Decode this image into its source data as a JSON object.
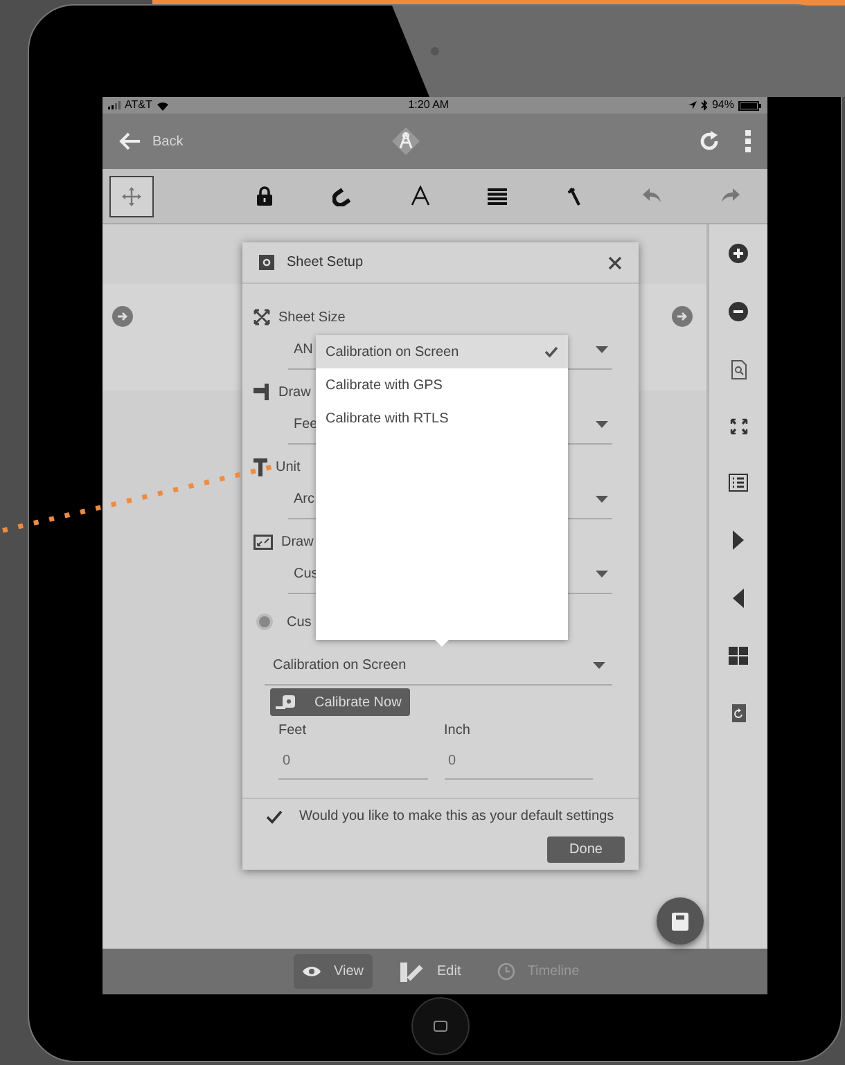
{
  "status_bar": {
    "carrier": "AT&T",
    "time": "1:20 AM",
    "battery": "94%"
  },
  "nav_bar": {
    "back": "Back"
  },
  "toolbar": {
    "tools": [
      {
        "kind": "move",
        "selected": true
      },
      {
        "kind": "lock",
        "selected": false
      },
      {
        "kind": "magnet",
        "selected": false
      },
      {
        "kind": "text",
        "selected": false
      },
      {
        "kind": "lines",
        "selected": false
      },
      {
        "kind": "pen",
        "selected": false
      },
      {
        "kind": "undo",
        "selected": false
      },
      {
        "kind": "redo",
        "selected": false
      }
    ]
  },
  "dialog": {
    "title": "Sheet Setup",
    "fields": [
      {
        "kind": "resize",
        "label": "Sheet Size",
        "value": "AN"
      },
      {
        "kind": "ruler",
        "label": "Draw",
        "value": "Fee"
      },
      {
        "kind": "unit",
        "label": "Unit",
        "value": "Arc"
      },
      {
        "kind": "frame",
        "label": "Draw",
        "value": "Cus"
      }
    ],
    "radio": {
      "label": "Cus",
      "checked": true
    },
    "calibration_select": {
      "value": "Calibration on Screen"
    },
    "calibrate_button": "Calibrate Now",
    "inputs": [
      {
        "label": "Feet",
        "value": "0"
      },
      {
        "label": "Inch",
        "value": "0"
      }
    ],
    "default_option": {
      "label": "Would you like to make this as your default settings",
      "checked": true
    },
    "done_button": "Done"
  },
  "dropdown": {
    "options": [
      {
        "label": "Calibration on Screen",
        "selected": true
      },
      {
        "label": "Calibrate with GPS",
        "selected": false
      },
      {
        "label": "Calibrate with RTLS",
        "selected": false
      }
    ]
  },
  "bottom_tabs": [
    {
      "label": "View",
      "selected": true,
      "disabled": false
    },
    {
      "label": "Edit",
      "selected": false,
      "disabled": false
    },
    {
      "label": "Timeline",
      "selected": false,
      "disabled": true
    }
  ]
}
